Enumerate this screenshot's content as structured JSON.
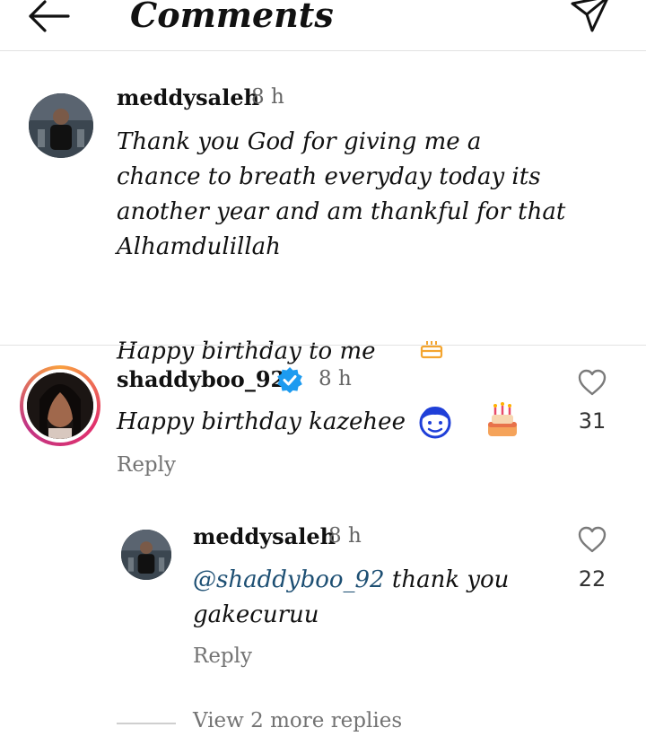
{
  "header": {
    "title": "Comments"
  },
  "comments": [
    {
      "username": "meddysaleh",
      "time": "8 h",
      "text": "Thank you God for giving me a\nchance to breath everyday today its\nanother year and am thankful for that\nAlhamdulillah\n\nHappy birthday to me"
    },
    {
      "username": "shaddyboo_92",
      "time": "8 h",
      "text": "Happy birthday kazehee",
      "likes": "31",
      "reply": "Reply"
    }
  ],
  "reply_comment": {
    "username": "meddysaleh",
    "time": "8 h",
    "mention": "@shaddyboo_92",
    "text": " thank you\ngakecuruu",
    "likes": "22",
    "reply": "Reply"
  },
  "more_replies": "View 2 more replies",
  "colors": {
    "mention": "#1d4f73",
    "verified": "#1d9bf0",
    "cake": "#f4a52f"
  }
}
